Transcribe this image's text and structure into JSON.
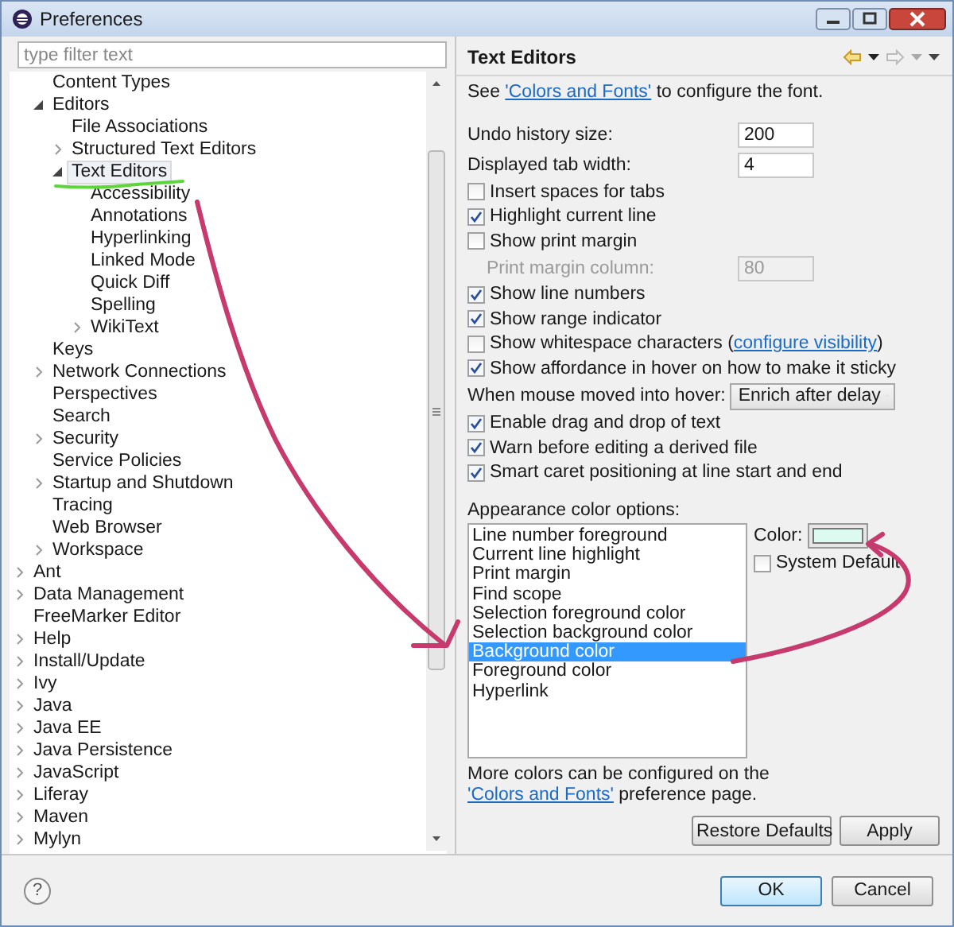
{
  "window": {
    "title": "Preferences"
  },
  "filter": {
    "placeholder": "type filter text"
  },
  "tree": {
    "continued_items": [
      {
        "label": "Content Types",
        "selected": false
      },
      {
        "label": "Editors",
        "selected": false,
        "expanded": true,
        "children": [
          {
            "label": "File Associations",
            "selected": false
          },
          {
            "label": "Structured Text Editors",
            "selected": false,
            "expanded": false
          },
          {
            "label": "Text Editors",
            "selected": true,
            "expanded": true,
            "children": [
              {
                "label": "Accessibility",
                "selected": false
              },
              {
                "label": "Annotations",
                "selected": false
              },
              {
                "label": "Hyperlinking",
                "selected": false
              },
              {
                "label": "Linked Mode",
                "selected": false
              },
              {
                "label": "Quick Diff",
                "selected": false
              },
              {
                "label": "Spelling",
                "selected": false
              },
              {
                "label": "WikiText",
                "selected": false,
                "expanded": false
              }
            ]
          }
        ]
      },
      {
        "label": "Keys",
        "selected": false
      },
      {
        "label": "Network Connections",
        "selected": false,
        "expanded": false
      },
      {
        "label": "Perspectives",
        "selected": false
      },
      {
        "label": "Search",
        "selected": false
      },
      {
        "label": "Security",
        "selected": false,
        "expanded": false
      },
      {
        "label": "Service Policies",
        "selected": false
      },
      {
        "label": "Startup and Shutdown",
        "selected": false,
        "expanded": false
      },
      {
        "label": "Tracing",
        "selected": false
      },
      {
        "label": "Web Browser",
        "selected": false
      },
      {
        "label": "Workspace",
        "selected": false,
        "expanded": false
      }
    ],
    "items": [
      {
        "label": "Ant",
        "selected": false,
        "expanded": false
      },
      {
        "label": "Data Management",
        "selected": false,
        "expanded": false
      },
      {
        "label": "FreeMarker Editor",
        "selected": false
      },
      {
        "label": "Help",
        "selected": false,
        "expanded": false
      },
      {
        "label": "Install/Update",
        "selected": false,
        "expanded": false
      },
      {
        "label": "Ivy",
        "selected": false,
        "expanded": false
      },
      {
        "label": "Java",
        "selected": false,
        "expanded": false
      },
      {
        "label": "Java EE",
        "selected": false,
        "expanded": false
      },
      {
        "label": "Java Persistence",
        "selected": false,
        "expanded": false
      },
      {
        "label": "JavaScript",
        "selected": false,
        "expanded": false
      },
      {
        "label": "Liferay",
        "selected": false,
        "expanded": false
      },
      {
        "label": "Maven",
        "selected": false,
        "expanded": false
      },
      {
        "label": "Mylyn",
        "selected": false,
        "expanded": false
      }
    ]
  },
  "page": {
    "title": "Text Editors",
    "intro": {
      "before": "See ",
      "link": "'Colors and Fonts'",
      "after": " to configure the font."
    },
    "settings": [
      {
        "kind": "field",
        "label": "Undo history size:",
        "value": "200",
        "disabled": false
      },
      {
        "kind": "field",
        "label": "Displayed tab width:",
        "value": "4",
        "disabled": false
      },
      {
        "kind": "checkbox",
        "label": "Insert spaces for tabs",
        "checked": false
      },
      {
        "kind": "checkbox",
        "label": "Highlight current line",
        "checked": true
      },
      {
        "kind": "checkbox",
        "label": "Show print margin",
        "checked": false
      },
      {
        "kind": "field",
        "label": "Print margin column:",
        "value": "80",
        "disabled": true
      },
      {
        "kind": "checkbox",
        "label": "Show line numbers",
        "checked": true
      },
      {
        "kind": "checkbox",
        "label": "Show range indicator",
        "checked": true
      },
      {
        "kind": "checkbox",
        "label": "Show whitespace characters (",
        "link": "configure visibility",
        "after": ")",
        "checked": false
      },
      {
        "kind": "checkbox",
        "label": "Show affordance in hover on how to make it sticky",
        "checked": true
      },
      {
        "kind": "dropdown",
        "label": "When mouse moved into hover:",
        "value": "Enrich after delay"
      },
      {
        "kind": "checkbox",
        "label": "Enable drag and drop of text",
        "checked": true
      },
      {
        "kind": "checkbox",
        "label": "Warn before editing a derived file",
        "checked": true
      },
      {
        "kind": "checkbox",
        "label": "Smart caret positioning at line start and end",
        "checked": true
      }
    ],
    "appearance": {
      "label": "Appearance color options:",
      "options": [
        {
          "label": "Line number foreground",
          "selected": false
        },
        {
          "label": "Current line highlight",
          "selected": false
        },
        {
          "label": "Print margin",
          "selected": false
        },
        {
          "label": "Find scope",
          "selected": false
        },
        {
          "label": "Selection foreground color",
          "selected": false
        },
        {
          "label": "Selection background color",
          "selected": false
        },
        {
          "label": "Background color",
          "selected": true
        },
        {
          "label": "Foreground color",
          "selected": false
        },
        {
          "label": "Hyperlink",
          "selected": false
        }
      ],
      "color_label": "Color:",
      "color": "#dcfaf0",
      "system_default": {
        "label": "System Default",
        "checked": false
      }
    },
    "footer": {
      "before": "More colors can be configured on the ",
      "link": "'Colors and Fonts'",
      "after": " preference page."
    },
    "buttons": [
      "Restore Defaults",
      "Apply"
    ]
  },
  "help_button": "?",
  "buttons": [
    {
      "label": "OK",
      "default": true
    },
    {
      "label": "Cancel",
      "default": false
    }
  ]
}
